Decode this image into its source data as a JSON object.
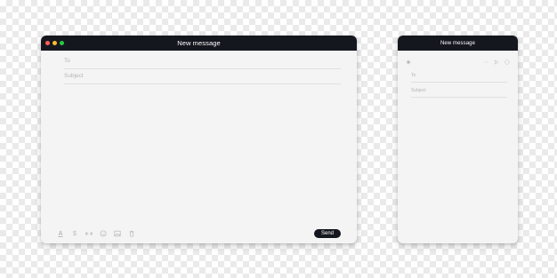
{
  "colors": {
    "titlebar": "#15171f",
    "window_bg": "#f4f4f4",
    "dot_close": "#ff5f57",
    "dot_minimize": "#febc2e",
    "dot_zoom": "#28c840",
    "placeholder": "#b5b5b5"
  },
  "large_window": {
    "title": "New message",
    "to_label": "To",
    "subject_label": "Subject",
    "toolbar_icons": [
      "text-format-icon",
      "dollar-icon",
      "link-icon",
      "emoji-icon",
      "image-icon",
      "trash-icon"
    ],
    "toolbar_glyphs": {
      "text": "A",
      "dollar": "$"
    },
    "send_label": "Send"
  },
  "small_window": {
    "title": "New message",
    "to_label": "To",
    "subject_label": "Subject",
    "controls": [
      "close-icon",
      "attachment-icon",
      "send-icon",
      "more-icon"
    ]
  }
}
